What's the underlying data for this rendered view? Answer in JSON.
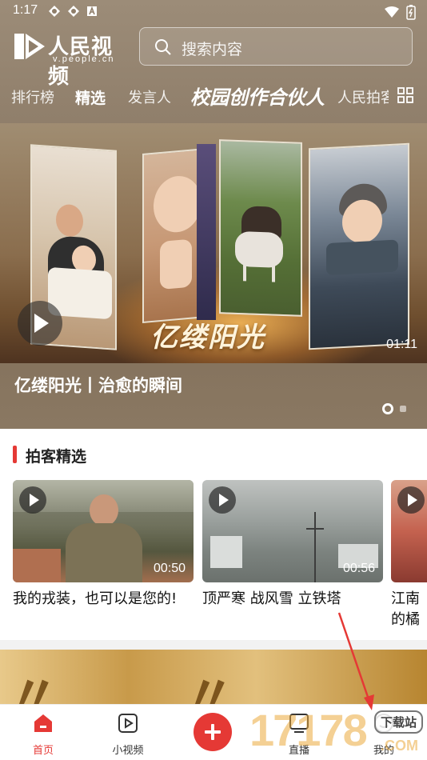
{
  "status_bar": {
    "time": "1:17"
  },
  "header": {
    "logo_text": "人民视频",
    "logo_url": "v.people.cn",
    "search_placeholder": "搜索内容"
  },
  "tabs": [
    {
      "label": "排行榜",
      "active": false
    },
    {
      "label": "精选",
      "active": true
    },
    {
      "label": "发言人",
      "active": false
    },
    {
      "label": "校园创作合伙人",
      "active": false
    },
    {
      "label": "人民拍客",
      "active": false
    }
  ],
  "hero": {
    "overlay_text": "亿缕阳光",
    "duration": "01:11",
    "caption": "亿缕阳光丨治愈的瞬间",
    "slide_index": 1,
    "slide_count": 2
  },
  "section": {
    "title": "拍客精选"
  },
  "cards": [
    {
      "title": "我的戎装，也可以是您的!",
      "duration": "00:50"
    },
    {
      "title": "顶严寒 战风雪 立铁塔",
      "duration": "00:56"
    },
    {
      "title": "江南的橘绿",
      "duration": ""
    }
  ],
  "bottom_nav": [
    {
      "label": "首页",
      "active": true
    },
    {
      "label": "小视频",
      "active": false
    },
    {
      "label": "直播",
      "active": false
    },
    {
      "label": "我的",
      "active": false
    }
  ],
  "watermark": {
    "digits": "17178",
    "badge": "下载站",
    "suffix": ".COM"
  },
  "colors": {
    "accent": "#e53935",
    "header_bg": "#8f7e6a"
  }
}
